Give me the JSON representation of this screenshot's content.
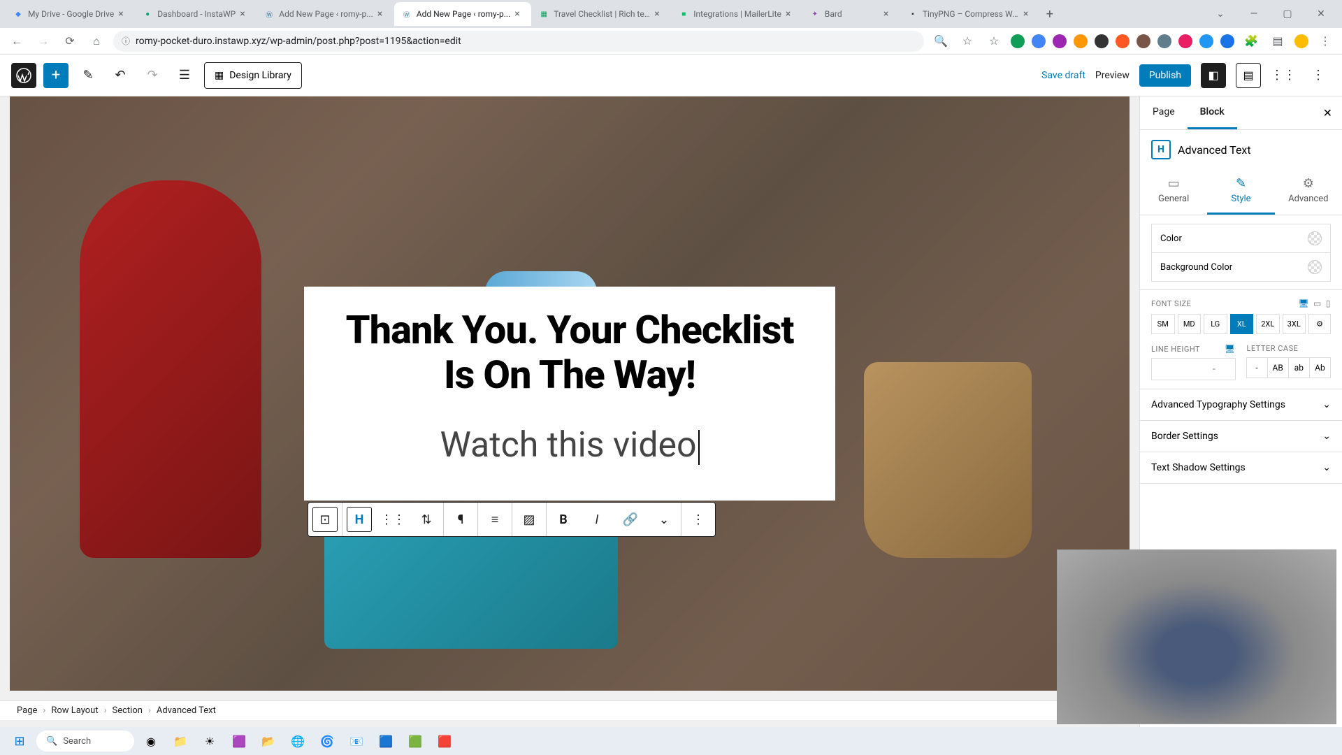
{
  "browser": {
    "tabs": [
      {
        "title": "My Drive - Google Drive",
        "favicon_color": "#4285f4"
      },
      {
        "title": "Dashboard - InstaWP",
        "favicon_color": "#0aa872"
      },
      {
        "title": "Add New Page ‹ romy-p...",
        "favicon_color": "#21759b"
      },
      {
        "title": "Add New Page ‹ romy-p...",
        "favicon_color": "#21759b",
        "active": true
      },
      {
        "title": "Travel Checklist | Rich tex...",
        "favicon_color": "#0f9d58"
      },
      {
        "title": "Integrations | MailerLite",
        "favicon_color": "#09c269"
      },
      {
        "title": "Bard",
        "favicon_color": "#8e44ad"
      },
      {
        "title": "TinyPNG – Compress We...",
        "favicon_color": "#333333"
      }
    ],
    "url": "romy-pocket-duro.instawp.xyz/wp-admin/post.php?post=1195&action=edit"
  },
  "editor": {
    "design_library": "Design Library",
    "save_draft": "Save draft",
    "preview": "Preview",
    "publish": "Publish",
    "heading": "Thank You. Your Checklist Is On The Way!",
    "subtext": "Watch this video",
    "breadcrumb": [
      "Page",
      "Row Layout",
      "Section",
      "Advanced Text"
    ]
  },
  "sidebar": {
    "tab_page": "Page",
    "tab_block": "Block",
    "block_name": "Advanced Text",
    "subtab_general": "General",
    "subtab_style": "Style",
    "subtab_advanced": "Advanced",
    "color_label": "Color",
    "bgcolor_label": "Background Color",
    "fontsize_label": "FONT SIZE",
    "sizes": [
      "SM",
      "MD",
      "LG",
      "XL",
      "2XL",
      "3XL"
    ],
    "active_size": "XL",
    "lineheight_label": "LINE HEIGHT",
    "lineheight_unit": "-",
    "lettercase_label": "LETTER CASE",
    "cases": [
      "-",
      "AB",
      "ab",
      "Ab"
    ],
    "panel_typography": "Advanced Typography Settings",
    "panel_border": "Border Settings",
    "panel_shadow": "Text Shadow Settings"
  },
  "taskbar": {
    "search_placeholder": "Search"
  }
}
